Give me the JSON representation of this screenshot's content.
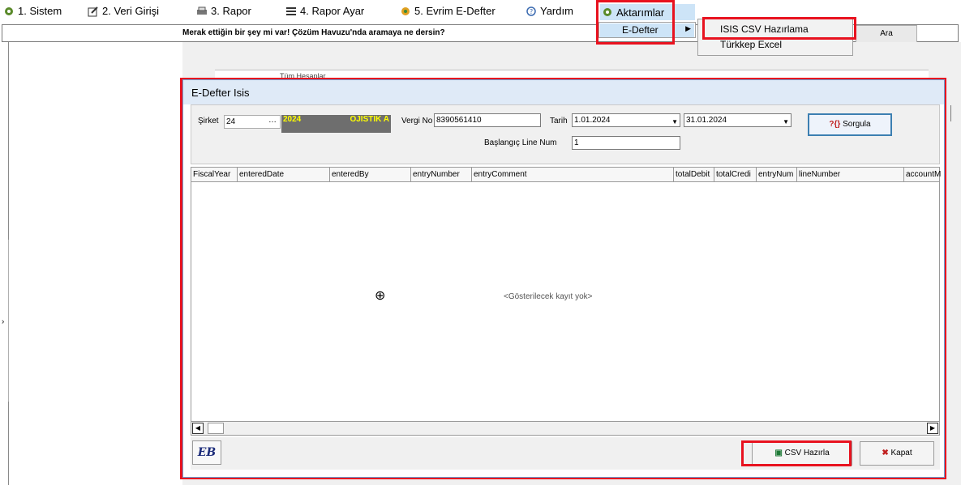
{
  "menu": [
    {
      "label": "1. Sistem",
      "icon": "gear-icon"
    },
    {
      "label": "2.  Veri Girişi",
      "icon": "edit-icon"
    },
    {
      "label": "3.  Rapor",
      "icon": "printer-icon"
    },
    {
      "label": "4.  Rapor Ayar",
      "icon": "report-settings-icon"
    },
    {
      "label": "5. Evrim E-Defter",
      "icon": "evrim-icon"
    },
    {
      "label": "Yardım",
      "icon": "help-icon"
    },
    {
      "label": "Aktarımlar",
      "icon": "transfer-icon"
    }
  ],
  "search": {
    "text": "Merak ettiğin bir şey mi var! Çözüm Havuzu'nda aramaya ne dersin?",
    "button": "Ara"
  },
  "background": {
    "partial_text": "Tüm Hesaplar"
  },
  "dropdown": {
    "level1": "E-Defter",
    "level2": [
      "ISIS CSV Hazırlama",
      "Türkkep Excel"
    ]
  },
  "window": {
    "title": "E-Defter Isis",
    "form": {
      "company_label": "Şirket",
      "company_value": "24",
      "company_year": "2024",
      "company_name": "OJISTIK A",
      "tax_label": "Vergi No",
      "tax_value": "8390561410",
      "date_label": "Tarih",
      "date_from": "1.01.2024",
      "date_to": "31.01.2024",
      "query_button": "Sorgula",
      "line_label": "Başlangıç Line Num",
      "line_value": "1"
    },
    "grid": {
      "columns": [
        "FiscalYear",
        "enteredDate",
        "enteredBy",
        "entryNumber",
        "entryComment",
        "totalDebit",
        "totalCredi",
        "entryNum",
        "lineNumber",
        "accountM"
      ],
      "empty_message": "<Gösterilecek kayıt yok>"
    },
    "footer": {
      "eb_label": "EB",
      "csv_button": "CSV Hazırla",
      "close_button": "Kapat"
    }
  },
  "colors": {
    "highlight_red": "#e8121f",
    "menu_selected": "#cde4f7",
    "window_border": "#6ca0d2",
    "company_bg": "#6e6e6e",
    "company_text": "#ffff00"
  }
}
